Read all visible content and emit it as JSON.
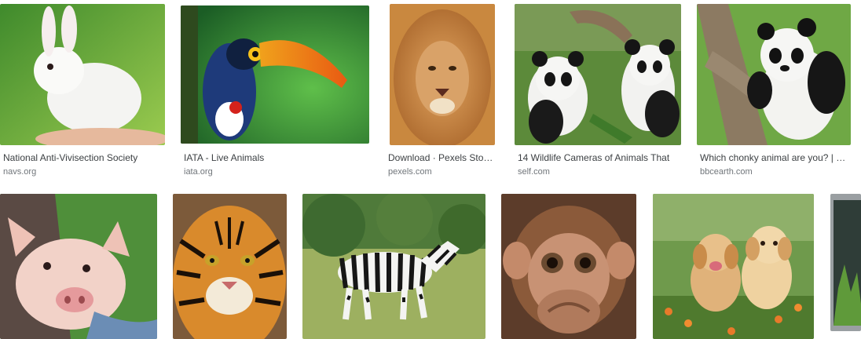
{
  "results": [
    {
      "title": "National Anti-Vivisection Society",
      "source": "navs.org",
      "image": "white-rabbit-image"
    },
    {
      "title": "IATA - Live Animals",
      "source": "iata.org",
      "image": "toucan-image"
    },
    {
      "title": "Download · Pexels Stock Photos",
      "source": "pexels.com",
      "image": "lion-image"
    },
    {
      "title": "14 Wildlife Cameras of Animals That",
      "source": "self.com",
      "image": "pandas-image"
    },
    {
      "title": "Which chonky animal are you? | BBC Earth",
      "source": "bbcearth.com",
      "image": "panda-tree-image"
    },
    {
      "image": "piglet-image"
    },
    {
      "image": "tiger-image"
    },
    {
      "image": "zebra-image"
    },
    {
      "image": "monkey-image"
    },
    {
      "image": "puppies-image"
    },
    {
      "image": "partial-image"
    }
  ]
}
